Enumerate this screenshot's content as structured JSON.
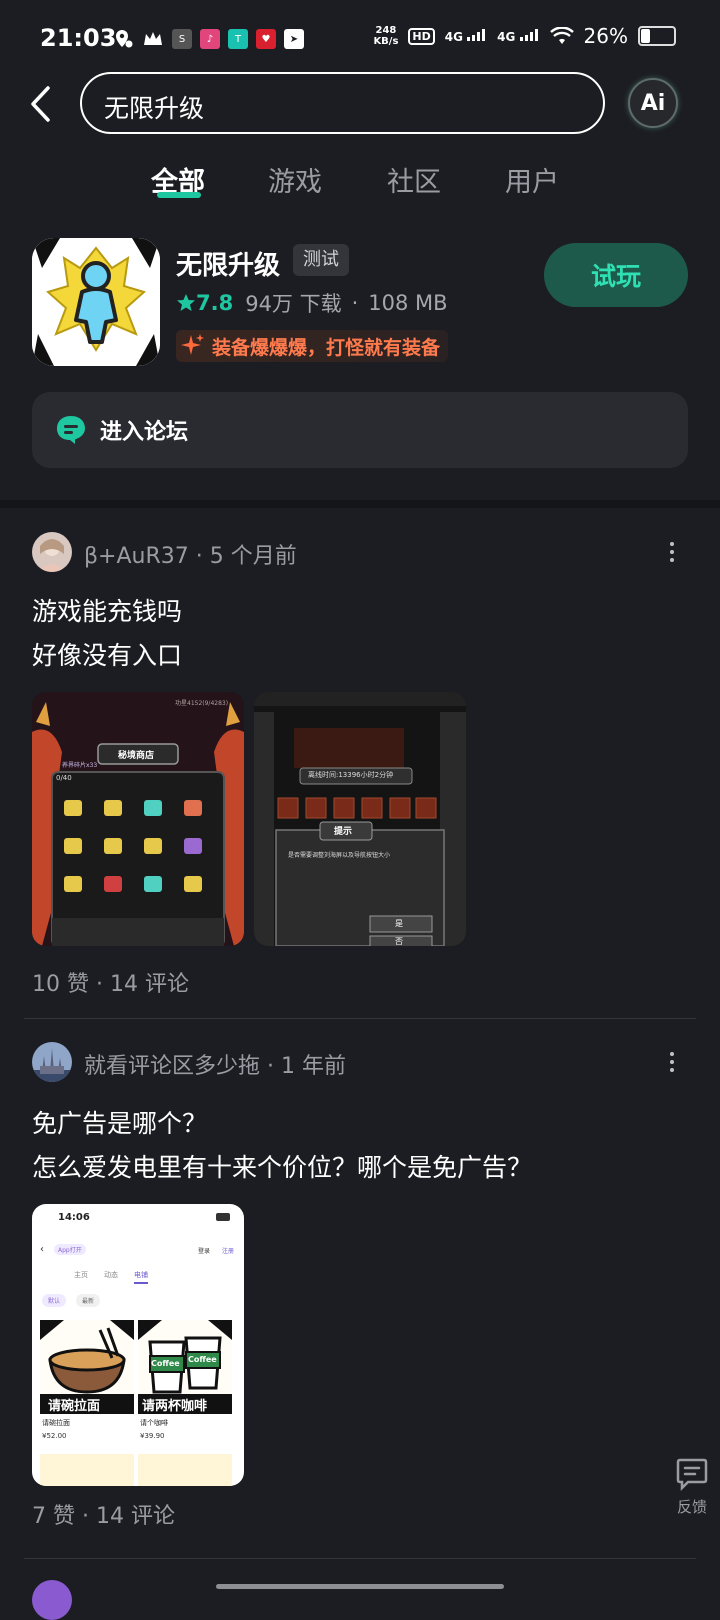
{
  "status_bar": {
    "time": "21:03",
    "net_speed_value": "248",
    "net_speed_unit": "KB/s",
    "hd": "HD",
    "sim1": "4G",
    "sim2": "4G",
    "battery": "26%",
    "battery_level": 0.26,
    "app_icons": [
      "location-icon",
      "crown-icon",
      "soul-app-icon",
      "pink-app-icon",
      "teal-app-icon",
      "red-app-icon",
      "send-icon"
    ]
  },
  "search": {
    "query": "无限升级",
    "ai_label": "Ai"
  },
  "tabs": [
    {
      "label": "全部",
      "active": true
    },
    {
      "label": "游戏",
      "active": false
    },
    {
      "label": "社区",
      "active": false
    },
    {
      "label": "用户",
      "active": false
    }
  ],
  "app": {
    "name": "无限升级",
    "badge": "测试",
    "rating": "7.8",
    "downloads": "94万 下载",
    "separator": "·",
    "size": "108 MB",
    "tagline": "装备爆爆爆，打怪就有装备",
    "try_button": "试玩",
    "forum_label": "进入论坛"
  },
  "posts": [
    {
      "author": "β+AuR37",
      "time": "5 个月前",
      "lines": [
        "游戏能充钱吗",
        "好像没有入口"
      ],
      "likes": "10 赞",
      "comments": "14 评论",
      "images": {
        "shop_title": "秘境商店",
        "shop_counter": "0/40",
        "shop_top": "功星4152(9/4283)",
        "shop_currency": "养界碎片x33",
        "offline_time": "离线时间:13396小时2分钟",
        "tip_title": "提示",
        "tip_text": "是否需要调整刘海屏以及导航按钮大小",
        "tip_yes": "是",
        "tip_no": "否"
      }
    },
    {
      "author": "就看评论区多少拖",
      "time": "1 年前",
      "lines": [
        "免广告是哪个？",
        "怎么爱发电里有十来个价位？哪个是免广告？"
      ],
      "likes": "7 赞",
      "comments": "14 评论",
      "images": {
        "phone_time": "14:06",
        "app_button": "App打开",
        "login": "登录",
        "register": "注册",
        "tabs": [
          "主页",
          "动态",
          "电铺"
        ],
        "filters": [
          "默认",
          "最新"
        ],
        "item1_caption": "请碗拉面",
        "item1_name": "请碗拉面",
        "item1_price": "¥52.00",
        "item2_caption": "请两杯咖啡",
        "item2_name": "请个咖啡",
        "item2_price": "¥39.90",
        "coffee_word": "Coffee"
      }
    }
  ],
  "feedback_label": "反馈",
  "colors": {
    "background": "#1c1d22",
    "accent": "#1fc7a0",
    "try_button_bg": "#1e5a4c",
    "tagline": "#ff7a4d"
  }
}
